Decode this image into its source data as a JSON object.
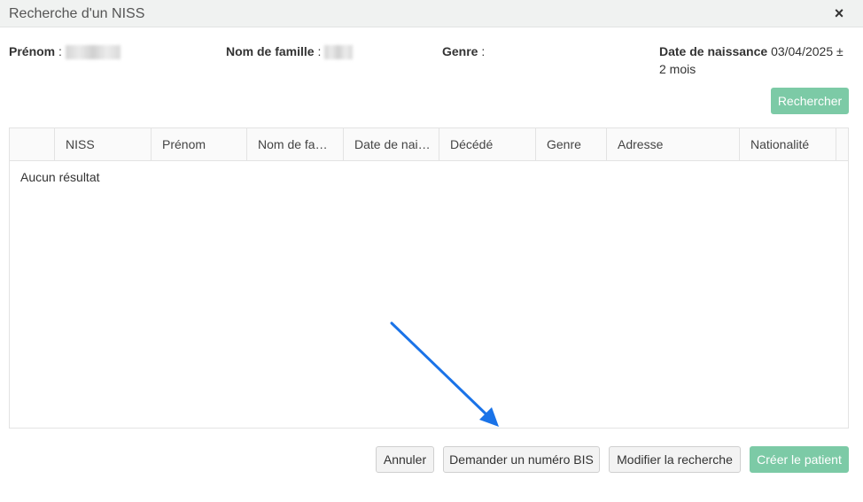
{
  "dialog": {
    "title": "Recherche d'un NISS",
    "close_label": "×"
  },
  "criteria": {
    "firstname_label": "Prénom",
    "lastname_label": "Nom de famille",
    "gender_label": "Genre",
    "birthdate_label": "Date de naissance",
    "birthdate_value_line1": "03/04/2025 ±",
    "birthdate_value_line2": "2 mois",
    "separator": " : "
  },
  "search_button": "Rechercher",
  "table": {
    "columns": [
      "",
      "NISS",
      "Prénom",
      "Nom de fa…",
      "Date de nai…",
      "Décédé",
      "Genre",
      "Adresse",
      "Nationalité"
    ],
    "empty_text": "Aucun résultat"
  },
  "footer": {
    "cancel": "Annuler",
    "request_bis": "Demander un numéro BIS",
    "modify_search": "Modifier la recherche",
    "create_patient": "Créer le patient"
  },
  "colors": {
    "primary": "#7ccaa6",
    "arrow": "#1a73e8"
  }
}
